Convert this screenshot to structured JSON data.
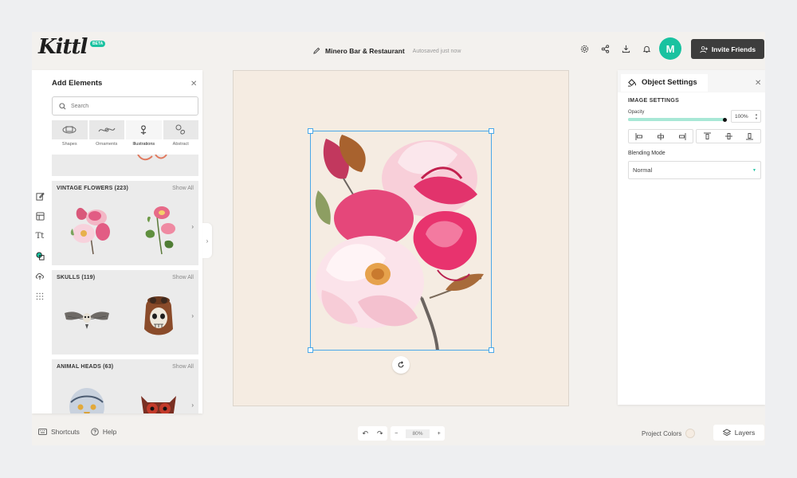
{
  "app": {
    "logo_text": "Kittl",
    "beta_badge": "BETA"
  },
  "header": {
    "document_name": "Minero Bar & Restaurant",
    "save_status": "Autosaved just now",
    "avatar_initial": "M",
    "invite_label": "Invite Friends"
  },
  "add_elements": {
    "title": "Add Elements",
    "search_placeholder": "Search",
    "categories": [
      {
        "label": "Shapes",
        "icon": "shapes-icon"
      },
      {
        "label": "Ornaments",
        "icon": "ornaments-icon"
      },
      {
        "label": "Illustrations",
        "icon": "flower-icon",
        "active": true
      },
      {
        "label": "Abstract",
        "icon": "abstract-icon"
      }
    ],
    "sections": [
      {
        "title": "VINTAGE FLOWERS (223)",
        "show_all": "Show All"
      },
      {
        "title": "SKULLS (119)",
        "show_all": "Show All"
      },
      {
        "title": "ANIMAL HEADS (63)",
        "show_all": "Show All"
      }
    ]
  },
  "object_settings": {
    "title": "Object Settings",
    "image_settings_label": "IMAGE SETTINGS",
    "opacity_label": "Opacity",
    "opacity_value": "100%",
    "opacity_fraction": 1.0,
    "blending_mode_label": "Blending Mode",
    "blending_mode_value": "Normal"
  },
  "footer": {
    "shortcuts_label": "Shortcuts",
    "help_label": "Help",
    "zoom_value": "80%",
    "zoom_minus": "−",
    "zoom_plus": "+",
    "project_colors_label": "Project Colors",
    "layers_label": "Layers"
  },
  "colors": {
    "accent": "#19c2a0",
    "canvas_bg": "#f5ece2",
    "selection": "#4aa8e8",
    "invite_bg": "#3d3d3d"
  }
}
